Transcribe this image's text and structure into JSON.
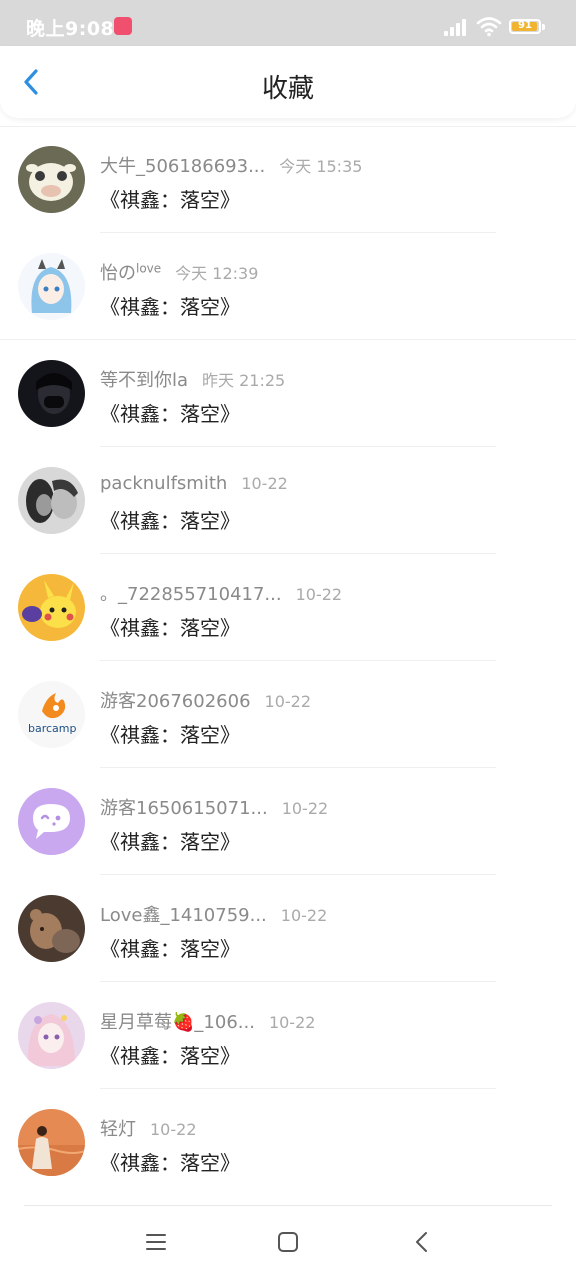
{
  "status_bar": {
    "time": "晚上9:08",
    "battery": "91"
  },
  "header": {
    "title": "收藏",
    "back_icon": "chevron-left-icon",
    "accent": "#2e8fe0"
  },
  "items": [
    {
      "user": "大牛_506186693...",
      "time": "今天 15:35",
      "content": "《祺鑫：落空》",
      "avatar": "cartoon-cow"
    },
    {
      "user": "怡の",
      "sup": "love",
      "time": "今天 12:39",
      "content": "《祺鑫：落空》",
      "avatar": "anime-girl-blue-hair"
    },
    {
      "user": "等不到你la",
      "time": "昨天 21:25",
      "content": "《祺鑫：落空》",
      "avatar": "dark-masked-person"
    },
    {
      "user": "packnulfsmith",
      "time": "10-22",
      "content": "《祺鑫：落空》",
      "avatar": "bw-couple"
    },
    {
      "user": "。_722855710417...",
      "time": "10-22",
      "content": "《祺鑫：落空》",
      "avatar": "pikachu"
    },
    {
      "user": "游客2067602606",
      "time": "10-22",
      "content": "《祺鑫：落空》",
      "avatar": "barcamp-logo",
      "avatar_text": "barcamp"
    },
    {
      "user": "游客1650615071...",
      "time": "10-22",
      "content": "《祺鑫：落空》",
      "avatar": "purple-chat-bubble"
    },
    {
      "user": "Love鑫_1410759...",
      "time": "10-22",
      "content": "《祺鑫：落空》",
      "avatar": "teddy-bear"
    },
    {
      "user": "星月草莓🍓_106...",
      "time": "10-22",
      "content": "《祺鑫：落空》",
      "avatar": "anime-girl-pink"
    },
    {
      "user": "轻灯",
      "time": "10-22",
      "content": "《祺鑫：落空》",
      "avatar": "orange-sunset-person"
    }
  ],
  "navbar": {
    "menu_icon": "menu-icon",
    "home_icon": "home-square-icon",
    "back_icon": "back-triangle-icon"
  }
}
